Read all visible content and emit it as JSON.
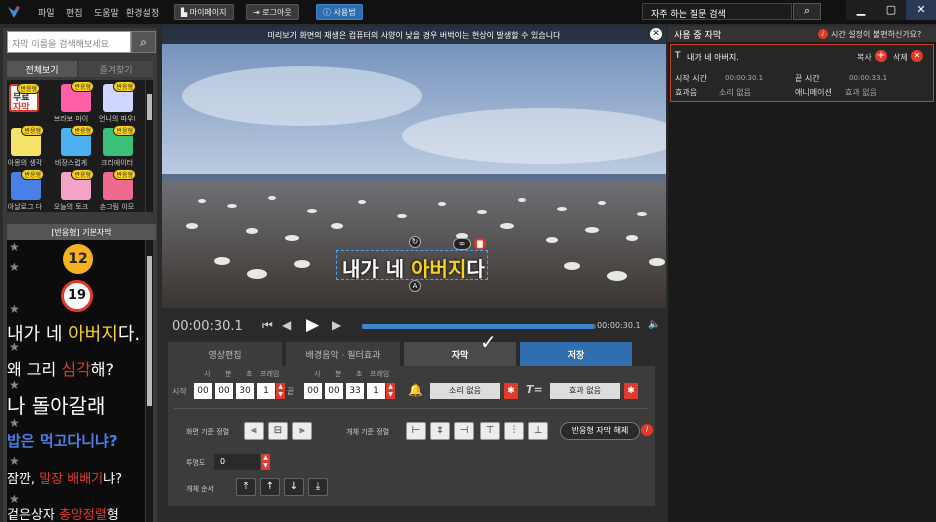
{
  "menu": {
    "items": [
      "파일",
      "편집",
      "도움말",
      "환경설정"
    ]
  },
  "toolbar": {
    "mypage": "마이페이지",
    "logout": "로그아웃",
    "usage": "사용법"
  },
  "faq": {
    "placeholder": "자주 하는 질문 검색"
  },
  "left": {
    "search_placeholder": "자막 이름을 검색해보세요",
    "tab_all": "전체보기",
    "tab_fav": "즐겨찾기",
    "badge": "반응형",
    "thumb_captions": [
      "",
      "브라보 마이",
      "언니의 파우더",
      "아몽의 생각",
      "비장스럽게",
      "크리에이터",
      "아날로그 다",
      "오늘의 토크",
      "손그림 이모"
    ],
    "first_thumb_text": [
      "무료",
      "자막"
    ],
    "section_title": "[반응형] 기본자막",
    "samples": [
      {
        "pre": "내가 네 ",
        "hl": "아버지",
        "post": "다."
      },
      {
        "pre": "왜 그리 ",
        "hl": "심각",
        "post": "해?"
      },
      {
        "pre": "나 돌아갈래",
        "hl": "",
        "post": ""
      },
      {
        "pre": "",
        "hl": "밥은 먹고다니냐?",
        "post": ""
      },
      {
        "pre": "잠깐, ",
        "hl": "말장 배배기",
        "post": "냐?"
      },
      {
        "pre": "겉은상자 ",
        "hl": "충앙정렬",
        "post": "형"
      }
    ],
    "numbers": [
      "12",
      "19"
    ]
  },
  "preview": {
    "notice": "미리보기 화면의 재생은 컴퓨터의 사양이 낮을 경우 버벅이는 현상이 발생할 수 있습니다",
    "caption_pre": "내가 네 ",
    "caption_hl": "아버지",
    "caption_post": "다"
  },
  "player": {
    "current": "00:00:30.1",
    "end": "00:00:30.1",
    "progress": 0.99
  },
  "tabs": {
    "video": "영상편집",
    "bgm": "배경음악 · 필터효과",
    "subtitle": "자막",
    "save": "저장"
  },
  "timing": {
    "start_label": "시작",
    "end_label": "끝",
    "units": [
      "시",
      "분",
      "초",
      "프레임"
    ],
    "start": [
      "00",
      "00",
      "30",
      "1"
    ],
    "end": [
      "00",
      "00",
      "33",
      "1"
    ],
    "sound": "소리 없음",
    "effect": "효과 없음"
  },
  "align": {
    "screen_label": "화면 기준 정렬",
    "object_label": "개체 기준 정렬",
    "release": "반응형 자막 해제",
    "opacity_label": "투명도",
    "opacity": "0",
    "order_label": "개체 순서"
  },
  "rightpanel": {
    "title": "사용 중 자막",
    "help": "시간 설정이 불편하신가요?",
    "item_text": "내가 네 아버지.",
    "copy": "복사",
    "delete": "삭제",
    "start_label": "시작 시간",
    "start": "00:00:30.1",
    "end_label": "끝 시간",
    "end": "00:00:33.1",
    "sound_label": "효과음",
    "sound": "소리 없음",
    "anim_label": "애니메이션",
    "anim": "효과 없음"
  },
  "colors": {
    "accent": "#2f6fb0",
    "highlight": "#f7d21f",
    "red": "#e23a2a"
  }
}
